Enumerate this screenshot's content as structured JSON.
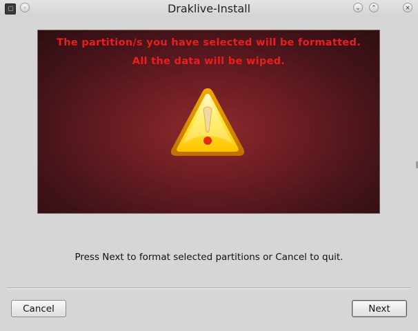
{
  "window": {
    "title": "Draklive-Install",
    "app_icon": "app-icon",
    "controls": [
      "minimize-icon",
      "maximize-icon",
      "close-icon"
    ],
    "menu_button_icon": "window-menu-icon"
  },
  "banner": {
    "line1": "The partition/s you have selected will be formatted.",
    "line2": "All the data will be wiped.",
    "icon": "warning-triangle-icon",
    "text_color": "#ee1c1c",
    "background_color": "#6d1d22"
  },
  "message": "Press Next to format selected partitions or Cancel to quit.",
  "buttons": {
    "cancel": "Cancel",
    "next": "Next"
  }
}
